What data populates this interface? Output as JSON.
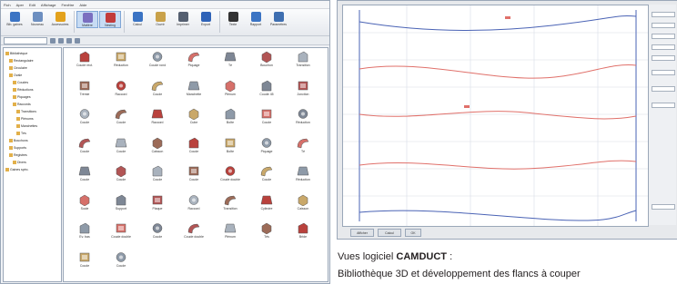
{
  "left_window": {
    "menu": [
      "Fich",
      "Aper",
      "Edit",
      "Affichage",
      "Fenêtre",
      "Aide"
    ],
    "toolbar": [
      {
        "label": "Bib. gaines",
        "color": "#3b74c4"
      },
      {
        "label": "Nouveau",
        "color": "#6d8fc0"
      },
      {
        "label": "Accessoires",
        "color": "#e3a21c"
      },
      {
        "label": "Matière",
        "color": "#7a6fc0",
        "selected": true
      },
      {
        "label": "Nesting",
        "color": "#c23b3b",
        "selected": true
      },
      {
        "label": "Calcul",
        "color": "#3b74c4"
      },
      {
        "label": "Ouvrir",
        "color": "#c9a24a"
      },
      {
        "label": "Imprimer",
        "color": "#555f70"
      },
      {
        "label": "Export",
        "color": "#2f63b8"
      },
      {
        "label": "Texte",
        "color": "#333333"
      },
      {
        "label": "Rapport",
        "color": "#3b74c4"
      },
      {
        "label": "Paramètres",
        "color": "#3f6fb1"
      }
    ],
    "tree": [
      "Bibliothèque",
      "Rectangulaire",
      "Circulaire",
      "Ovale",
      "Coudes",
      "Réductions",
      "Piquages",
      "Raccords",
      "Transitions",
      "Plénums",
      "Manchettes",
      "Tés",
      "Bouchons",
      "Supports",
      "Registres",
      "Divers",
      "Gaines spéc."
    ],
    "shapes_rows": [
      [
        "Coude rect.",
        "Réduction",
        "Coude rond",
        "Piquage",
        "Té",
        "Bouchon",
        "Transition"
      ],
      [
        "Trémie",
        "Raccord",
        "Coude",
        "Manchette",
        "Plénum",
        "Coude 45",
        "Jonction"
      ],
      [
        "Coude",
        "Coude",
        "Raccord",
        "Cube",
        "Boîte",
        "Coude",
        "Réduction"
      ],
      [
        "Coude",
        "Coude",
        "Caisson",
        "Coude",
        "Boîte",
        "Piquage",
        "Té"
      ],
      [
        "Coude",
        "Coude",
        "Coude",
        "Coude",
        "Coude double",
        "Coude",
        "Réduction"
      ],
      [
        "Socle",
        "Support",
        "Plaque",
        "Raccord",
        "Transition",
        "Cylindre",
        "Caisson"
      ],
      [
        "Ev. bas",
        "Coude double",
        "Coude",
        "Coude double",
        "Plénum",
        "Tés",
        "Bride"
      ],
      [
        "Coude",
        "Coude"
      ]
    ]
  },
  "right_window": {
    "buttons": [
      "Afficher",
      "Calcul",
      "OK"
    ]
  },
  "caption": {
    "prefix": "Vues logiciel",
    "software": "CAMDUCT",
    "suffix": " :",
    "line2": "Bibliothèque 3D et développement des flancs à couper"
  }
}
